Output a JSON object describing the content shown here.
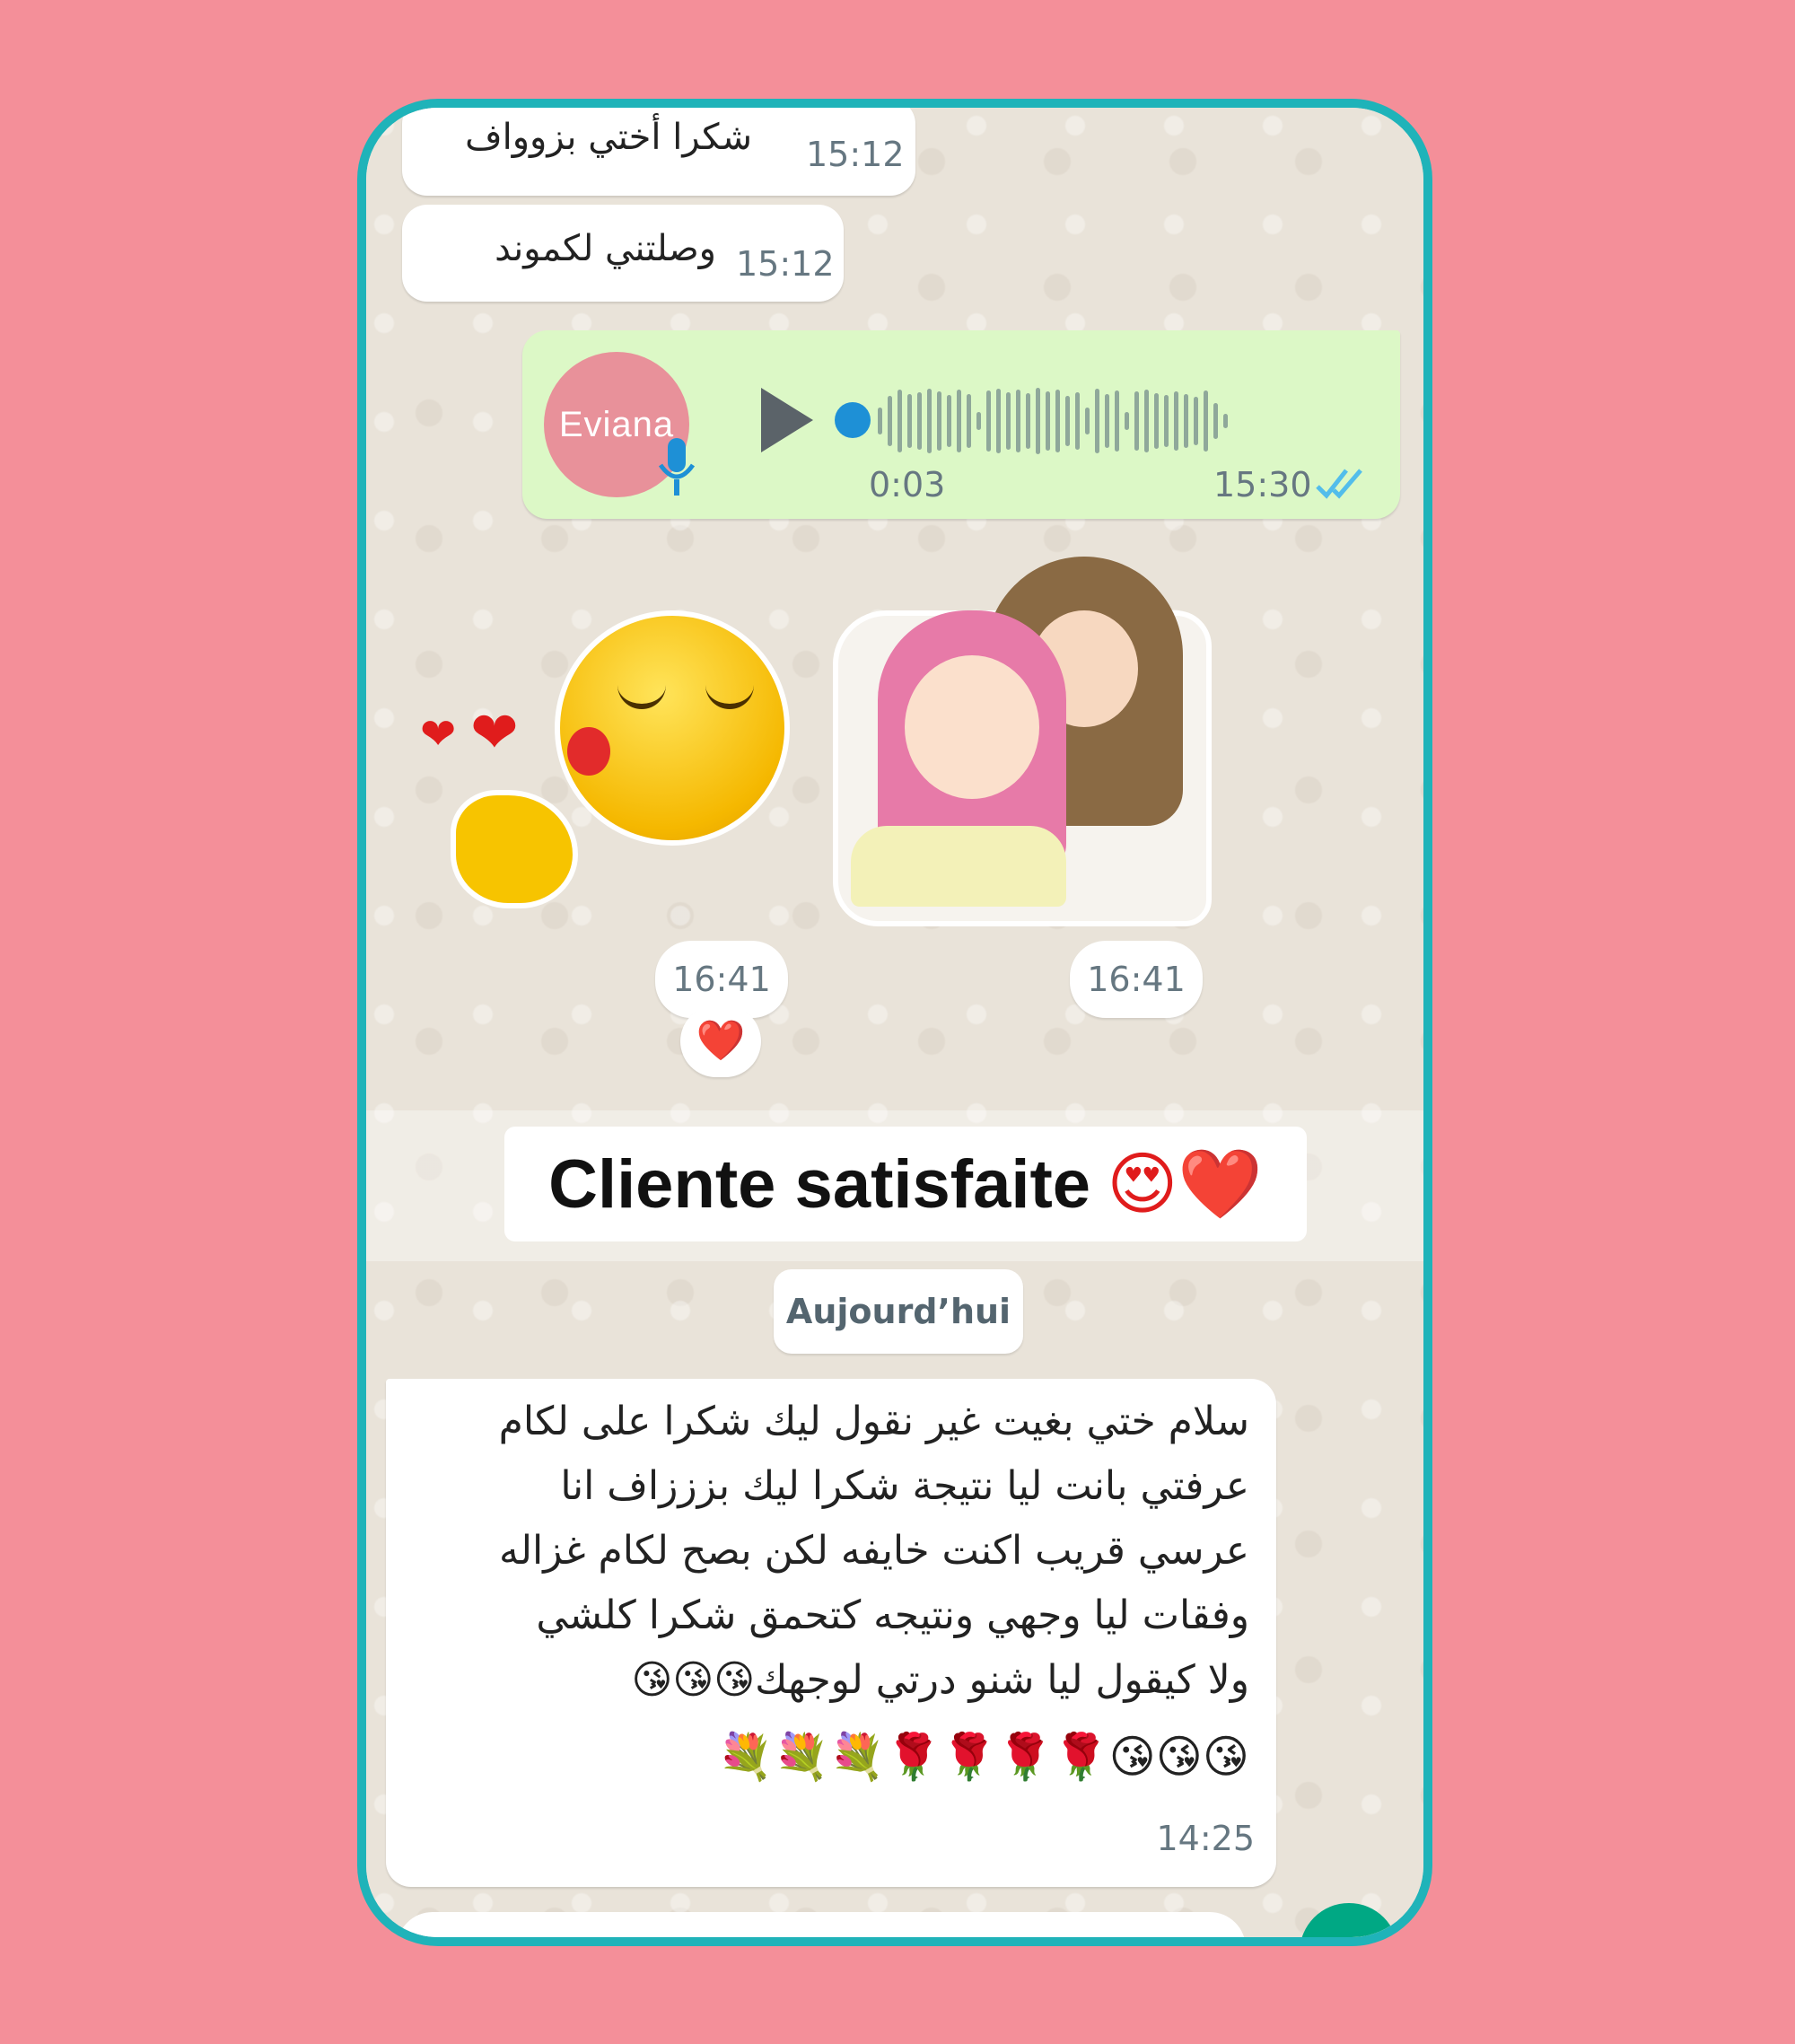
{
  "messages": {
    "m1": {
      "text": "شكرا أختي بزوواف",
      "time": "15:12"
    },
    "m2": {
      "text": "وصلتني لكموند",
      "time": "15:12"
    },
    "voice": {
      "avatar_text": "Eviana",
      "duration": "0:03",
      "time": "15:30",
      "status_icon": "double-check-icon"
    },
    "sticker1": {
      "time": "16:41",
      "reaction": "❤️"
    },
    "sticker2": {
      "time": "16:41"
    },
    "long": {
      "lines": [
        "سلام ختي بغيت غير نقول ليك شكرا على لكام",
        "عرفتي بانت ليا نتيجة شكرا ليك بزززاف انا",
        "عرسي قريب اكنت خايفه لكن بصح لكام غزاله",
        "وفقات ليا وجهي ونتيجه كتحمق شكرا كلشي",
        "ولا كيقول ليا شنو درتي لوجهك😘😘😘",
        "😘😘😘🌹🌹🌹🌹💐💐💐"
      ],
      "time": "14:25"
    }
  },
  "banner": {
    "text": "Cliente satisfaite",
    "emoji": "😍❤️"
  },
  "date_divider": "Aujourd’hui",
  "colors": {
    "frame": "#1fb3b9",
    "page_bg": "#f48f99",
    "outgoing": "#dcf8c6",
    "tick": "#53bdeb"
  }
}
